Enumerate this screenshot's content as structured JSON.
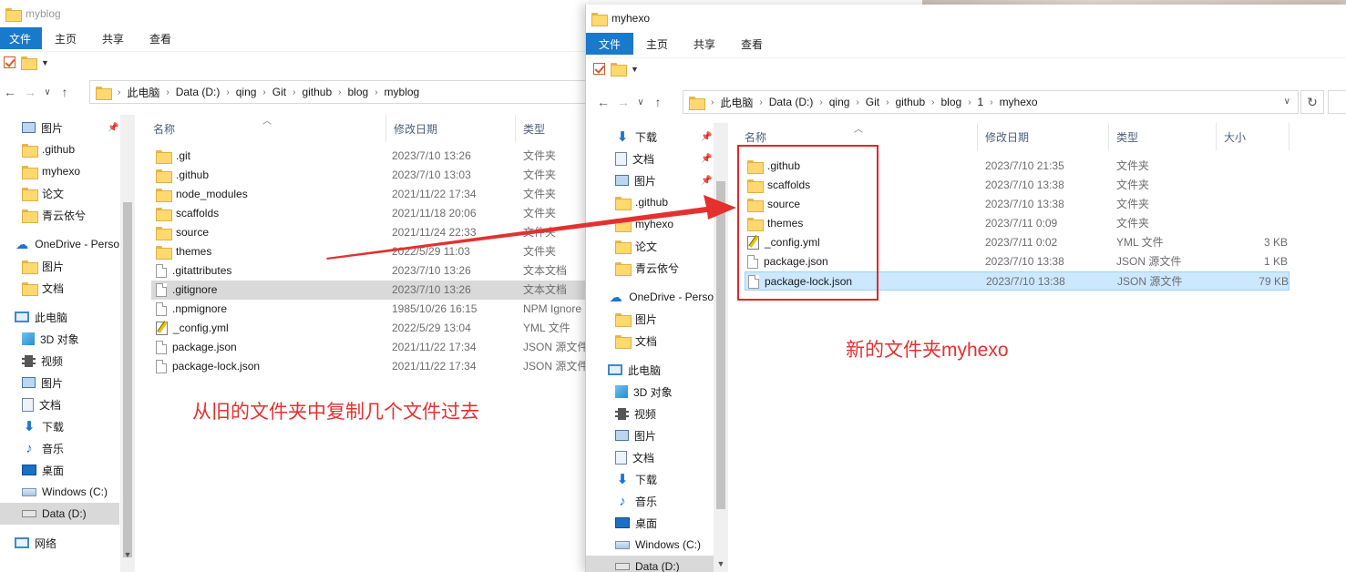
{
  "window_left": {
    "title": "myblog",
    "tabs": [
      "文件",
      "主页",
      "共享",
      "查看"
    ],
    "breadcrumb": [
      "此电脑",
      "Data (D:)",
      "qing",
      "Git",
      "github",
      "blog",
      "myblog"
    ],
    "nav_items": [
      {
        "label": "图片",
        "icon": "pictures-icon",
        "pinned": true
      },
      {
        "label": ".github",
        "icon": "folder-icon"
      },
      {
        "label": "myhexo",
        "icon": "folder-icon"
      },
      {
        "label": "论文",
        "icon": "folder-icon"
      },
      {
        "label": "青云依兮",
        "icon": "folder-icon"
      },
      {
        "label": "OneDrive - Perso",
        "icon": "onedrive-icon"
      },
      {
        "label": "图片",
        "icon": "folder-icon"
      },
      {
        "label": "文档",
        "icon": "folder-icon"
      },
      {
        "label": "此电脑",
        "icon": "this-pc-icon"
      },
      {
        "label": "3D 对象",
        "icon": "3d-objects-icon"
      },
      {
        "label": "视频",
        "icon": "videos-icon"
      },
      {
        "label": "图片",
        "icon": "pictures-icon"
      },
      {
        "label": "文档",
        "icon": "documents-icon"
      },
      {
        "label": "下载",
        "icon": "downloads-icon"
      },
      {
        "label": "音乐",
        "icon": "music-icon"
      },
      {
        "label": "桌面",
        "icon": "desktop-icon"
      },
      {
        "label": "Windows (C:)",
        "icon": "drive-c-icon"
      },
      {
        "label": "Data (D:)",
        "icon": "drive-d-icon",
        "selected": true
      },
      {
        "label": "网络",
        "icon": "network-icon"
      }
    ],
    "columns": [
      "名称",
      "修改日期",
      "类型"
    ],
    "files": [
      {
        "name": ".git",
        "date": "2023/7/10 13:26",
        "type": "文件夹",
        "icon": "folder-icon"
      },
      {
        "name": ".github",
        "date": "2023/7/10 13:03",
        "type": "文件夹",
        "icon": "folder-icon"
      },
      {
        "name": "node_modules",
        "date": "2021/11/22 17:34",
        "type": "文件夹",
        "icon": "folder-icon"
      },
      {
        "name": "scaffolds",
        "date": "2021/11/18 20:06",
        "type": "文件夹",
        "icon": "folder-icon"
      },
      {
        "name": "source",
        "date": "2021/11/24 22:33",
        "type": "文件夹",
        "icon": "folder-icon"
      },
      {
        "name": "themes",
        "date": "2022/5/29 11:03",
        "type": "文件夹",
        "icon": "folder-icon"
      },
      {
        "name": ".gitattributes",
        "date": "2023/7/10 13:26",
        "type": "文本文档",
        "icon": "file-icon"
      },
      {
        "name": ".gitignore",
        "date": "2023/7/10 13:26",
        "type": "文本文档",
        "icon": "file-icon",
        "selected": true
      },
      {
        "name": ".npmignore",
        "date": "1985/10/26 16:15",
        "type": "NPM Ignore",
        "icon": "file-icon"
      },
      {
        "name": "_config.yml",
        "date": "2022/5/29 13:04",
        "type": "YML 文件",
        "icon": "yml-file-icon"
      },
      {
        "name": "package.json",
        "date": "2021/11/22 17:34",
        "type": "JSON 源文件",
        "icon": "file-icon"
      },
      {
        "name": "package-lock.json",
        "date": "2021/11/22 17:34",
        "type": "JSON 源文件",
        "icon": "file-icon"
      }
    ]
  },
  "window_right": {
    "title": "myhexo",
    "tabs": [
      "文件",
      "主页",
      "共享",
      "查看"
    ],
    "breadcrumb": [
      "此电脑",
      "Data (D:)",
      "qing",
      "Git",
      "github",
      "blog",
      "1",
      "myhexo"
    ],
    "nav_items": [
      {
        "label": "下载",
        "icon": "downloads-icon",
        "pinned": true
      },
      {
        "label": "文档",
        "icon": "documents-icon",
        "pinned": true
      },
      {
        "label": "图片",
        "icon": "pictures-icon",
        "pinned": true
      },
      {
        "label": ".github",
        "icon": "folder-icon"
      },
      {
        "label": "myhexo",
        "icon": "folder-icon"
      },
      {
        "label": "论文",
        "icon": "folder-icon"
      },
      {
        "label": "青云依兮",
        "icon": "folder-icon"
      },
      {
        "label": "OneDrive - Perso",
        "icon": "onedrive-icon"
      },
      {
        "label": "图片",
        "icon": "folder-icon"
      },
      {
        "label": "文档",
        "icon": "folder-icon"
      },
      {
        "label": "此电脑",
        "icon": "this-pc-icon"
      },
      {
        "label": "3D 对象",
        "icon": "3d-objects-icon"
      },
      {
        "label": "视频",
        "icon": "videos-icon"
      },
      {
        "label": "图片",
        "icon": "pictures-icon"
      },
      {
        "label": "文档",
        "icon": "documents-icon"
      },
      {
        "label": "下载",
        "icon": "downloads-icon"
      },
      {
        "label": "音乐",
        "icon": "music-icon"
      },
      {
        "label": "桌面",
        "icon": "desktop-icon"
      },
      {
        "label": "Windows (C:)",
        "icon": "drive-c-icon"
      },
      {
        "label": "Data (D:)",
        "icon": "drive-d-icon",
        "selected": true
      }
    ],
    "columns": [
      "名称",
      "修改日期",
      "类型",
      "大小"
    ],
    "files": [
      {
        "name": ".github",
        "date": "2023/7/10 21:35",
        "type": "文件夹",
        "size": "",
        "icon": "folder-icon"
      },
      {
        "name": "scaffolds",
        "date": "2023/7/10 13:38",
        "type": "文件夹",
        "size": "",
        "icon": "folder-icon"
      },
      {
        "name": "source",
        "date": "2023/7/10 13:38",
        "type": "文件夹",
        "size": "",
        "icon": "folder-icon"
      },
      {
        "name": "themes",
        "date": "2023/7/11 0:09",
        "type": "文件夹",
        "size": "",
        "icon": "folder-icon"
      },
      {
        "name": "_config.yml",
        "date": "2023/7/11 0:02",
        "type": "YML 文件",
        "size": "3 KB",
        "icon": "yml-file-icon"
      },
      {
        "name": "package.json",
        "date": "2023/7/10 13:38",
        "type": "JSON 源文件",
        "size": "1 KB",
        "icon": "file-icon"
      },
      {
        "name": "package-lock.json",
        "date": "2023/7/10 13:38",
        "type": "JSON 源文件",
        "size": "79 KB",
        "icon": "file-icon",
        "selected": true
      }
    ]
  },
  "annotations": {
    "left_text": "从旧的文件夹中复制几个文件过去",
    "right_text": "新的文件夹myhexo",
    "color": "#e53030"
  },
  "colors": {
    "ribbon_file_tab": "#1979ca",
    "selection_blue": "#cce8ff",
    "selection_gray": "#d9d9d9",
    "folder_yellow": "#ffd86e"
  }
}
